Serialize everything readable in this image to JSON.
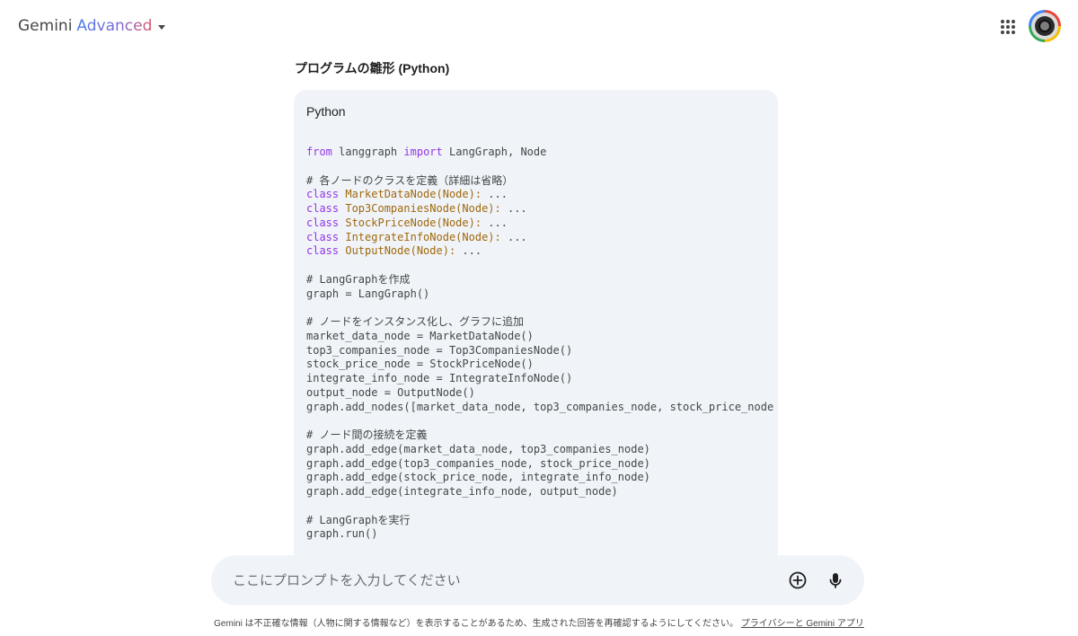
{
  "header": {
    "brand_name": "Gemini",
    "brand_tier": "Advanced",
    "accent_gradient": [
      "#4b7bec",
      "#7a6ad8",
      "#d9566b"
    ],
    "apps_icon": "apps-grid-icon",
    "avatar_icon": "account-avatar"
  },
  "response": {
    "heading": "プログラムの雛形 (Python)",
    "code_language": "Python",
    "code_lines": [
      [
        {
          "t": "from",
          "c": "kw"
        },
        {
          "t": " langgraph "
        },
        {
          "t": "import",
          "c": "kw"
        },
        {
          "t": " LangGraph, Node"
        }
      ],
      [],
      [
        {
          "t": "# 各ノードのクラスを定義（詳細は省略）",
          "c": "cm"
        }
      ],
      [
        {
          "t": "class",
          "c": "kw"
        },
        {
          "t": " "
        },
        {
          "t": "MarketDataNode(Node):",
          "c": "cls"
        },
        {
          "t": " ..."
        }
      ],
      [
        {
          "t": "class",
          "c": "kw"
        },
        {
          "t": " "
        },
        {
          "t": "Top3CompaniesNode(Node):",
          "c": "cls"
        },
        {
          "t": " ..."
        }
      ],
      [
        {
          "t": "class",
          "c": "kw"
        },
        {
          "t": " "
        },
        {
          "t": "StockPriceNode(Node):",
          "c": "cls"
        },
        {
          "t": " ..."
        }
      ],
      [
        {
          "t": "class",
          "c": "kw"
        },
        {
          "t": " "
        },
        {
          "t": "IntegrateInfoNode(Node):",
          "c": "cls"
        },
        {
          "t": " ..."
        }
      ],
      [
        {
          "t": "class",
          "c": "kw"
        },
        {
          "t": " "
        },
        {
          "t": "OutputNode(Node):",
          "c": "cls"
        },
        {
          "t": " ..."
        }
      ],
      [],
      [
        {
          "t": "# LangGraphを作成",
          "c": "cm"
        }
      ],
      [
        {
          "t": "graph = LangGraph()"
        }
      ],
      [],
      [
        {
          "t": "# ノードをインスタンス化し、グラフに追加",
          "c": "cm"
        }
      ],
      [
        {
          "t": "market_data_node = MarketDataNode()"
        }
      ],
      [
        {
          "t": "top3_companies_node = Top3CompaniesNode()"
        }
      ],
      [
        {
          "t": "stock_price_node = StockPriceNode()"
        }
      ],
      [
        {
          "t": "integrate_info_node = IntegrateInfoNode()"
        }
      ],
      [
        {
          "t": "output_node = OutputNode()"
        }
      ],
      [
        {
          "t": "graph.add_nodes([market_data_node, top3_companies_node, stock_price_node"
        }
      ],
      [],
      [
        {
          "t": "# ノード間の接続を定義",
          "c": "cm"
        }
      ],
      [
        {
          "t": "graph.add_edge(market_data_node, top3_companies_node)"
        }
      ],
      [
        {
          "t": "graph.add_edge(top3_companies_node, stock_price_node)"
        }
      ],
      [
        {
          "t": "graph.add_edge(stock_price_node, integrate_info_node)"
        }
      ],
      [
        {
          "t": "graph.add_edge(integrate_info_node, output_node)"
        }
      ],
      [],
      [
        {
          "t": "# LangGraphを実行",
          "c": "cm"
        }
      ],
      [
        {
          "t": "graph.run()"
        }
      ]
    ],
    "colors": {
      "keyword": "#9334e6",
      "class_name": "#a0680c",
      "code_bg": "#f0f4f9"
    }
  },
  "prompt": {
    "placeholder": "ここにプロンプトを入力してください",
    "value": "",
    "add_icon": "add-circle-icon",
    "mic_icon": "microphone-icon"
  },
  "footer": {
    "disclaimer": "Gemini は不正確な情報（人物に関する情報など）を表示することがあるため、生成された回答を再確認するようにしてください。",
    "link": "プライバシーと Gemini アプリ"
  }
}
